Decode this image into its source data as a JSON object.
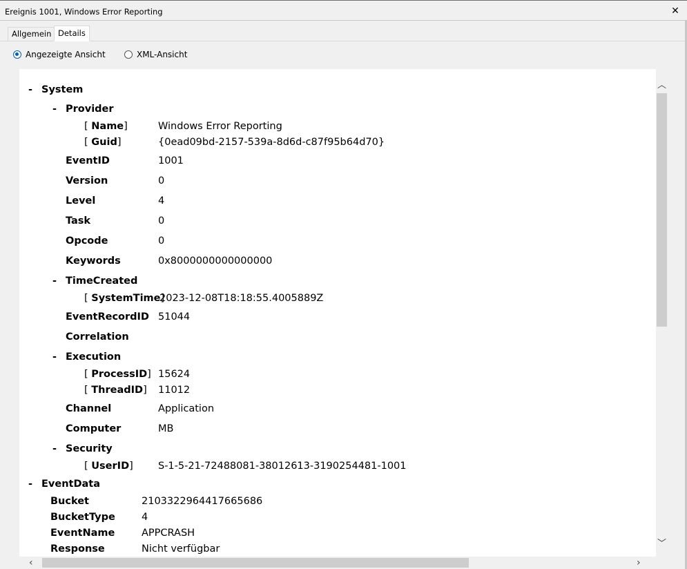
{
  "window": {
    "title": "Ereignis 1001, Windows Error Reporting",
    "close_glyph": "✕"
  },
  "tabs": [
    {
      "label": "Allgemein"
    },
    {
      "label": "Details"
    }
  ],
  "view_options": {
    "friendly": "Angezeigte Ansicht",
    "xml": "XML-Ansicht",
    "selected": "friendly"
  },
  "tree": {
    "collapse_symbol": "-",
    "system": {
      "label": "System",
      "provider": {
        "label": "Provider",
        "name_key": "Name",
        "name_value": "Windows Error Reporting",
        "guid_key": "Guid",
        "guid_value": "{0ead09bd-2157-539a-8d6d-c87f95b64d70}"
      },
      "fields": [
        {
          "key": "EventID",
          "value": "1001"
        },
        {
          "key": "Version",
          "value": "0"
        },
        {
          "key": "Level",
          "value": "4"
        },
        {
          "key": "Task",
          "value": "0"
        },
        {
          "key": "Opcode",
          "value": "0"
        },
        {
          "key": "Keywords",
          "value": "0x8000000000000000"
        }
      ],
      "time_created": {
        "label": "TimeCreated",
        "key": "SystemTime",
        "value": "2023-12-08T18:18:55.4005889Z"
      },
      "event_record_id": {
        "key": "EventRecordID",
        "value": "51044"
      },
      "correlation": {
        "key": "Correlation"
      },
      "execution": {
        "label": "Execution",
        "process_key": "ProcessID",
        "process_value": "15624",
        "thread_key": "ThreadID",
        "thread_value": "11012"
      },
      "channel": {
        "key": "Channel",
        "value": "Application"
      },
      "computer": {
        "key": "Computer",
        "value": "MB"
      },
      "security": {
        "label": "Security",
        "key": "UserID",
        "value": "S-1-5-21-72488081-38012613-3190254481-1001"
      }
    },
    "event_data": {
      "label": "EventData",
      "fields": [
        {
          "key": "Bucket",
          "value": "2103322964417665686"
        },
        {
          "key": "BucketType",
          "value": "4"
        },
        {
          "key": "EventName",
          "value": "APPCRASH"
        },
        {
          "key": "Response",
          "value": "Nicht verfügbar"
        }
      ]
    }
  },
  "scroll": {
    "up": "︿",
    "down": "﹀",
    "left": "‹",
    "right": "›"
  }
}
